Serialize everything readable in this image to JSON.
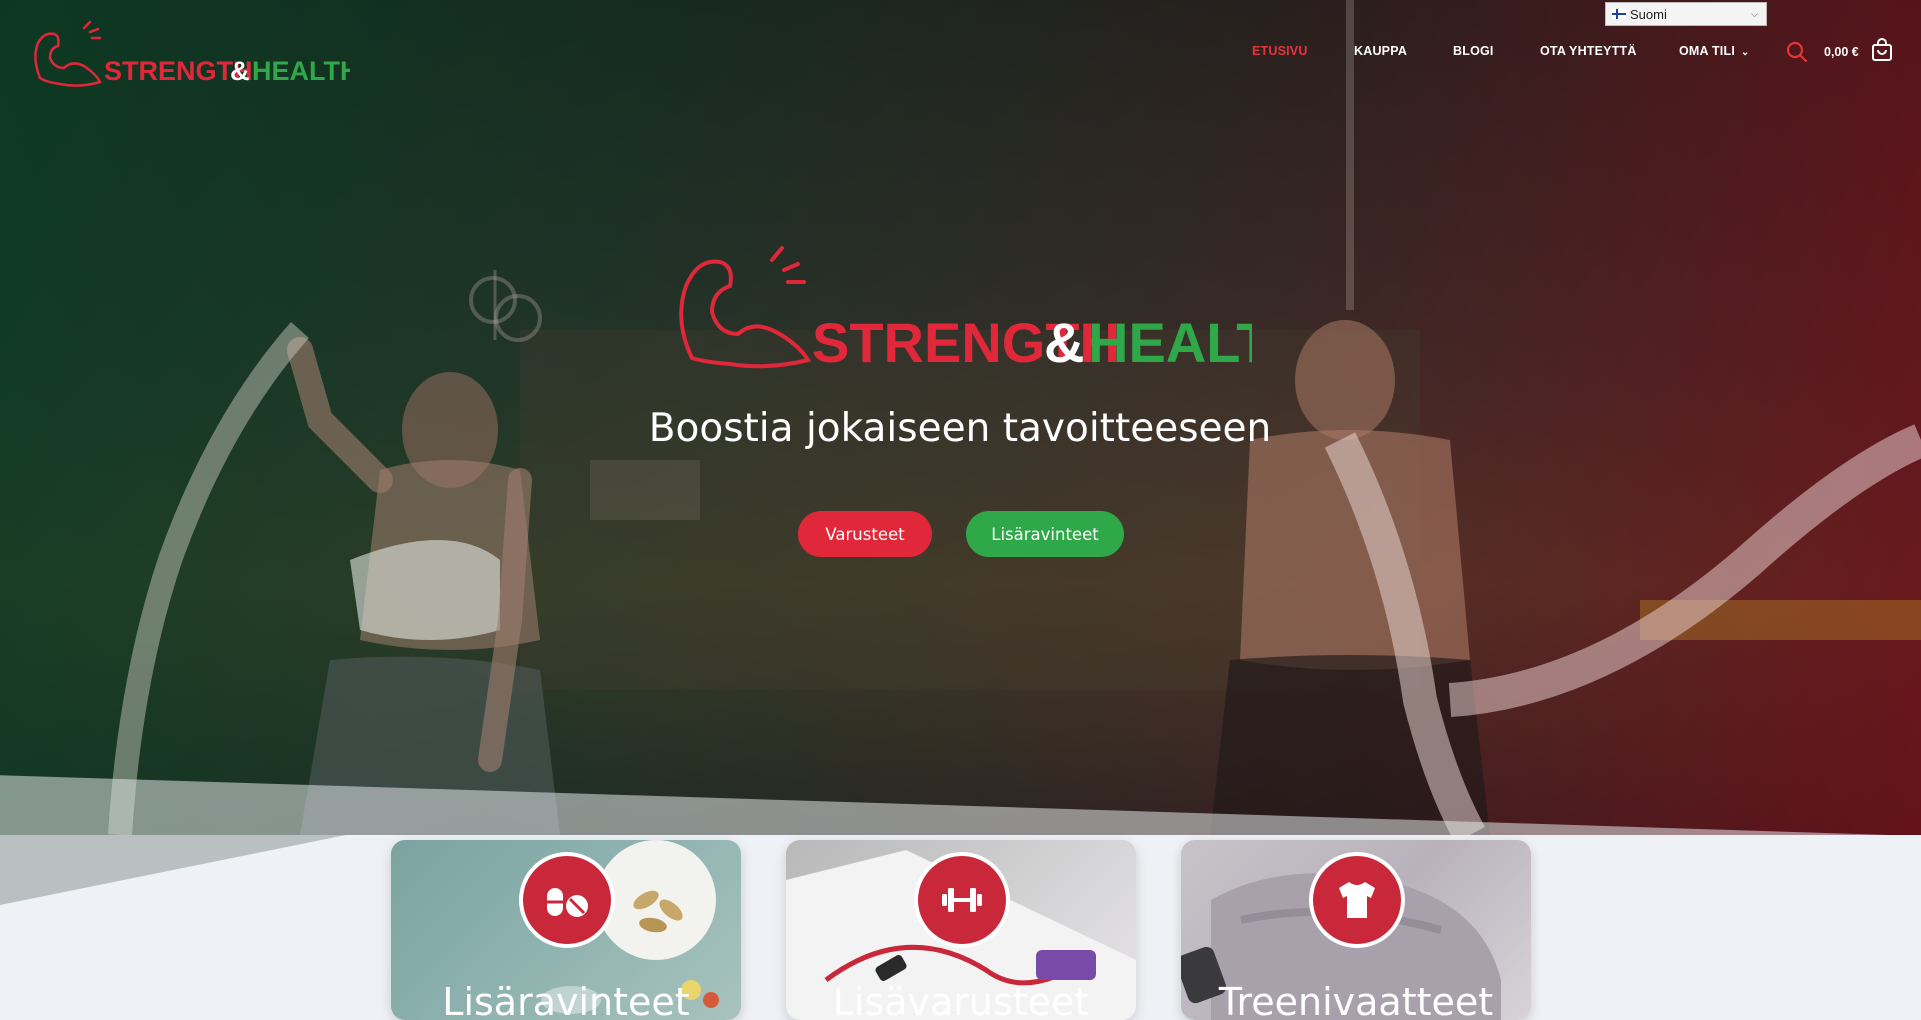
{
  "brand": {
    "name_part1": "STRENGTH",
    "ampersand": "&",
    "name_part2": "HEALTH",
    "colors": {
      "red": "#e0283a",
      "green": "#2fa84a",
      "white": "#ffffff"
    }
  },
  "language": {
    "selected": "Suomi",
    "flag_icon": "finland-flag-icon"
  },
  "nav": {
    "items": [
      {
        "label": "ETUSIVU",
        "active": true
      },
      {
        "label": "KAUPPA",
        "active": false
      },
      {
        "label": "BLOGI",
        "active": false
      },
      {
        "label": "OTA YHTEYTTÄ",
        "active": false
      },
      {
        "label": "OMA TILI",
        "active": false,
        "dropdown": true
      }
    ],
    "search_icon": "search-icon",
    "cart_total": "0,00 €",
    "cart_icon": "shopping-bag-icon"
  },
  "hero": {
    "tagline": "Boostia jokaiseen tavoitteeseen",
    "buttons": [
      {
        "label": "Varusteet",
        "color": "#e0283a"
      },
      {
        "label": "Lisäravinteet",
        "color": "#2fa84a"
      }
    ]
  },
  "categories": [
    {
      "title": "Lisäravinteet",
      "icon": "pills-icon"
    },
    {
      "title": "Lisävarusteet",
      "icon": "dumbbell-icon"
    },
    {
      "title": "Treenivaatteet",
      "icon": "tshirt-icon"
    }
  ]
}
